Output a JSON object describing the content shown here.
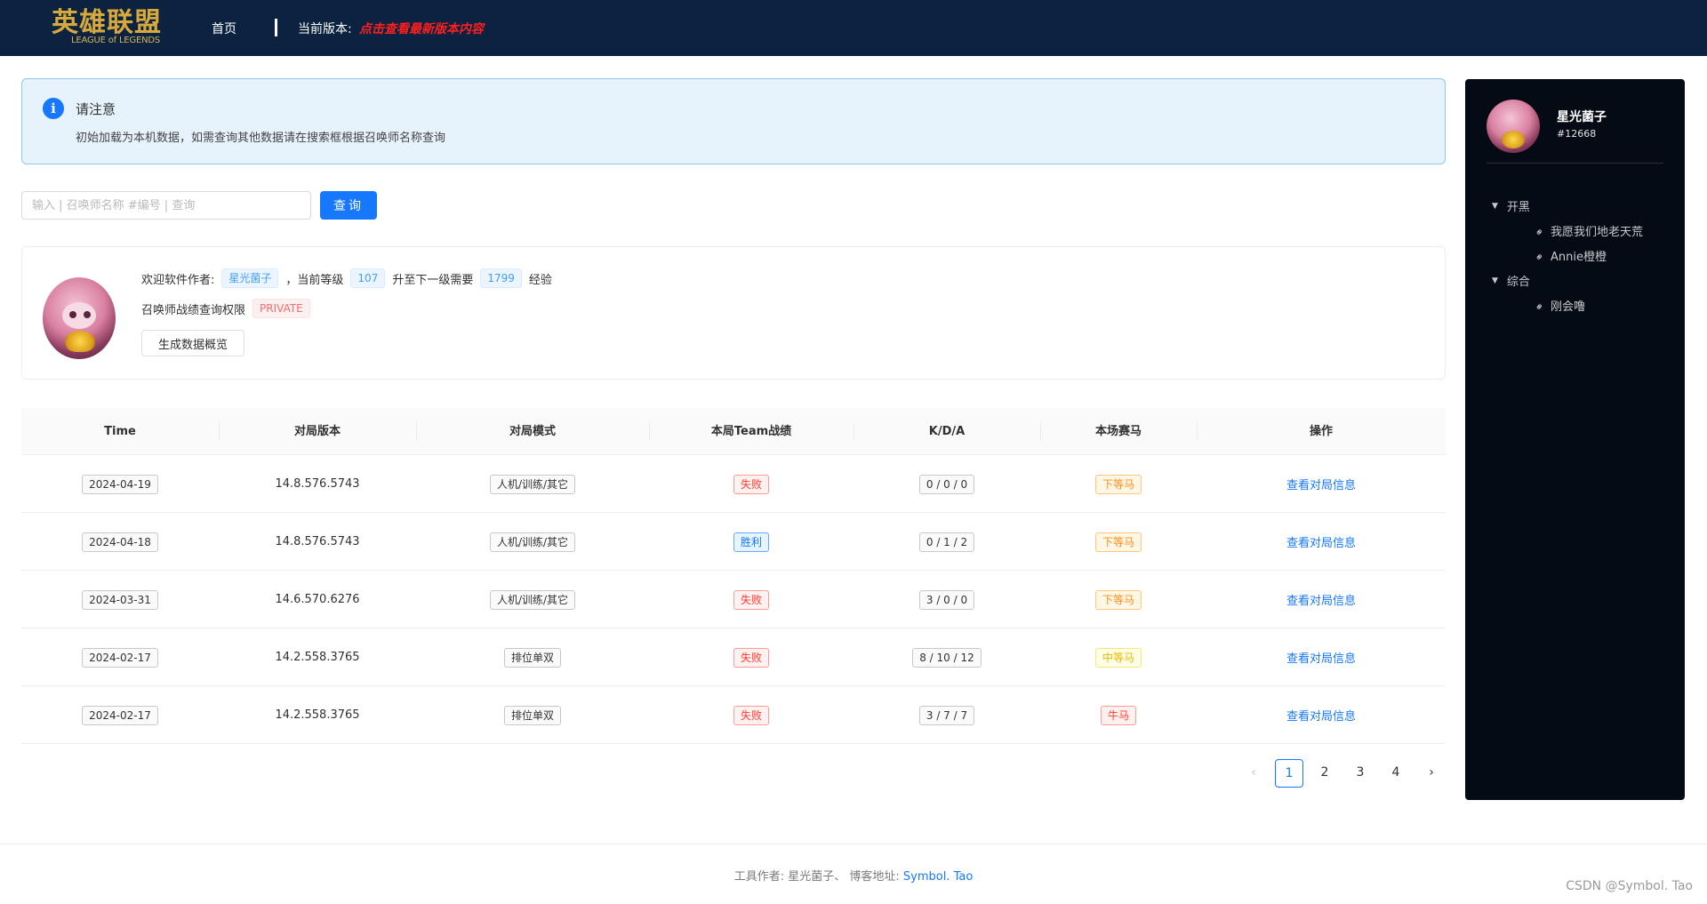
{
  "header": {
    "logo_text": "英雄联盟",
    "logo_sub": "LEAGUE of LEGENDS",
    "nav_home": "首页",
    "version_label": "当前版本:",
    "version_link": "点击查看最新版本内容"
  },
  "alert": {
    "icon": "i",
    "title": "请注意",
    "description": "初始加载为本机数据，如需查询其他数据请在搜索框根据召唤师名称查询"
  },
  "search": {
    "placeholder": "输入 | 召唤师名称 #编号 | 查询",
    "value": "",
    "button": "查询"
  },
  "profile": {
    "welcome": "欢迎软件作者:",
    "author": "星光菌子",
    "level_prefix": "，当前等级",
    "level": "107",
    "next_prefix": "升至下一级需要",
    "exp_needed": "1799",
    "exp_suffix": "经验",
    "privacy_label": "召唤师战绩查询权限",
    "privacy_value": "PRIVATE",
    "overview_button": "生成数据概览"
  },
  "table": {
    "headers": [
      "Time",
      "对局版本",
      "对局模式",
      "本局Team战绩",
      "K/D/A",
      "本场赛马",
      "操作"
    ],
    "rows": [
      {
        "time": "2024-04-19",
        "version": "14.8.576.5743",
        "mode": "人机/训练/其它",
        "result": "失败",
        "kda": "0 / 0 / 0",
        "horse": "下等马",
        "action": "查看对局信息"
      },
      {
        "time": "2024-04-18",
        "version": "14.8.576.5743",
        "mode": "人机/训练/其它",
        "result": "胜利",
        "kda": "0 / 1 / 2",
        "horse": "下等马",
        "action": "查看对局信息"
      },
      {
        "time": "2024-03-31",
        "version": "14.6.570.6276",
        "mode": "人机/训练/其它",
        "result": "失败",
        "kda": "3 / 0 / 0",
        "horse": "下等马",
        "action": "查看对局信息"
      },
      {
        "time": "2024-02-17",
        "version": "14.2.558.3765",
        "mode": "排位单双",
        "result": "失败",
        "kda": "8 / 10 / 12",
        "horse": "中等马",
        "action": "查看对局信息"
      },
      {
        "time": "2024-02-17",
        "version": "14.2.558.3765",
        "mode": "排位单双",
        "result": "失败",
        "kda": "3 / 7 / 7",
        "horse": "牛马",
        "action": "查看对局信息"
      }
    ]
  },
  "pagination": {
    "prev": "‹",
    "pages": [
      "1",
      "2",
      "3",
      "4"
    ],
    "current": "1",
    "next": "›"
  },
  "sidebar": {
    "name": "星光菌子",
    "tag": "#12668",
    "groups": [
      {
        "label": "开黑",
        "items": [
          "我愿我们地老天荒",
          "Annie橙橙"
        ]
      },
      {
        "label": "综合",
        "items": [
          "刚会噜"
        ]
      }
    ]
  },
  "footer": {
    "text": "工具作者: 星光菌子、 博客地址:",
    "link": "Symbol. Tao"
  },
  "watermark": "CSDN @Symbol. Tao",
  "colors": {
    "header_bg": "#0b2340",
    "primary": "#1677ff",
    "sidebar_bg": "#050b14",
    "version_link": "#ff1f1f"
  }
}
